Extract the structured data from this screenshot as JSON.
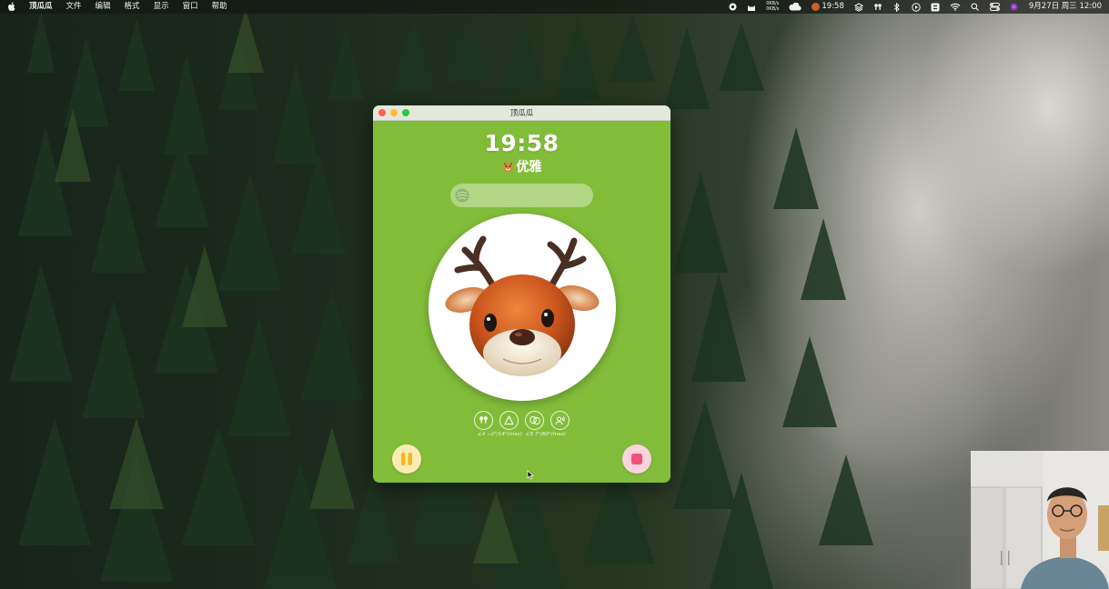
{
  "menubar": {
    "app_name": "顶瓜瓜",
    "menus": [
      "文件",
      "编辑",
      "格式",
      "显示",
      "窗口",
      "帮助"
    ],
    "netspeed_up": "0KB/s",
    "netspeed_down": "0KB/s",
    "tray_time": "19:58",
    "datetime": "9月27日 周三  12:00",
    "icons": [
      "record-icon",
      "cat-icon",
      "cloud-icon",
      "deer-icon",
      "stack-icon",
      "airpods-icon",
      "bluetooth-icon",
      "play-icon",
      "dollar-icon",
      "wifi-icon",
      "search-icon",
      "control-center-icon",
      "siri-icon"
    ]
  },
  "window": {
    "title": "顶瓜瓜",
    "clock": "19:58",
    "mood_label": "优雅",
    "mood_icon": "emoji-face-icon",
    "progress_fraction": 0.0,
    "avatar": "deer-animoji",
    "device_icons": [
      "airpods-icon",
      "triangle-icon",
      "masks-icon",
      "person-sound-icon"
    ],
    "angle_readout": [
      "∠4 −2°/14°(max)",
      "∠8 7°/60°(max)"
    ],
    "pause_icon": "pause-icon",
    "stop_icon": "stop-icon",
    "colors": {
      "background": "#82bd3a",
      "pause_button": "#fcebb0",
      "pause_glyph": "#f2b522",
      "stop_button": "#fbd3dc",
      "stop_glyph": "#f04f7f"
    }
  },
  "webcam": {
    "label": "webcam-overlay"
  }
}
